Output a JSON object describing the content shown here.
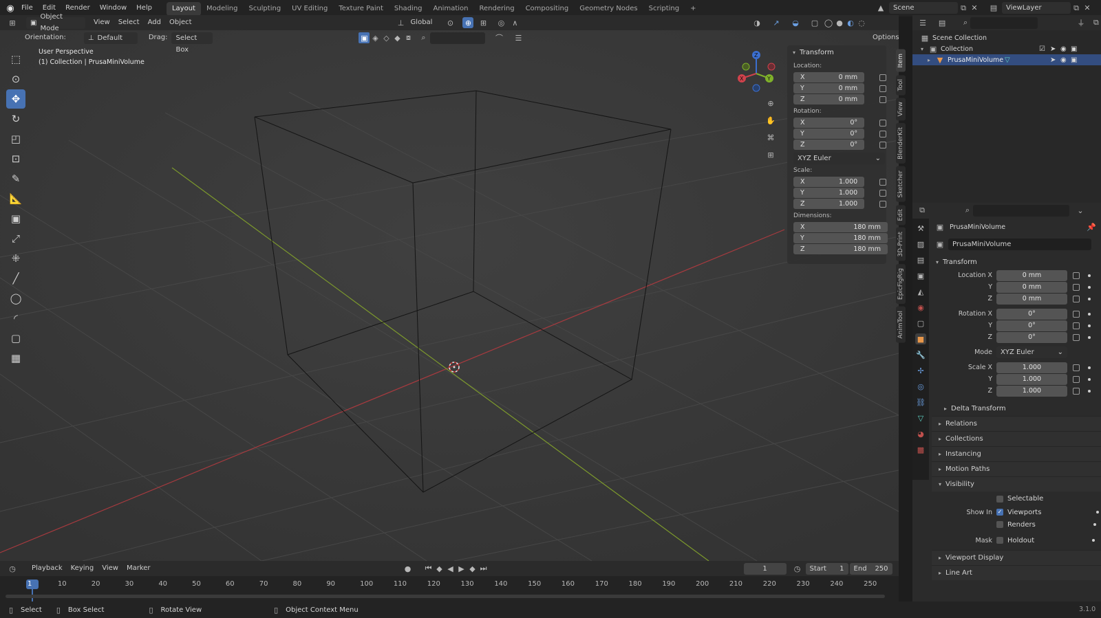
{
  "topbar": {
    "menus": [
      "File",
      "Edit",
      "Render",
      "Window",
      "Help"
    ],
    "workspaces": [
      "Layout",
      "Modeling",
      "Sculpting",
      "UV Editing",
      "Texture Paint",
      "Shading",
      "Animation",
      "Rendering",
      "Compositing",
      "Geometry Nodes",
      "Scripting"
    ],
    "active_workspace": "Layout",
    "plus": "+",
    "scene": "Scene",
    "view_layer": "ViewLayer"
  },
  "viewport_header": {
    "mode": "Object Mode",
    "menus": [
      "View",
      "Select",
      "Add",
      "Object"
    ],
    "transform_space": "Global",
    "orientation_label": "Orientation:",
    "orientation_value": "Default",
    "drag_label": "Drag:",
    "drag_value": "Select Box",
    "options": "Options"
  },
  "viewport": {
    "perspective": "User Perspective",
    "collection_info": "(1) Collection | PrusaMiniVolume"
  },
  "npanel": {
    "title": "Transform",
    "location_label": "Location:",
    "location": [
      {
        "axis": "X",
        "value": "0 mm"
      },
      {
        "axis": "Y",
        "value": "0 mm"
      },
      {
        "axis": "Z",
        "value": "0 mm"
      }
    ],
    "rotation_label": "Rotation:",
    "rotation": [
      {
        "axis": "X",
        "value": "0°"
      },
      {
        "axis": "Y",
        "value": "0°"
      },
      {
        "axis": "Z",
        "value": "0°"
      }
    ],
    "rotation_mode": "XYZ Euler",
    "scale_label": "Scale:",
    "scale": [
      {
        "axis": "X",
        "value": "1.000"
      },
      {
        "axis": "Y",
        "value": "1.000"
      },
      {
        "axis": "Z",
        "value": "1.000"
      }
    ],
    "dimensions_label": "Dimensions:",
    "dimensions": [
      {
        "axis": "X",
        "value": "180 mm"
      },
      {
        "axis": "Y",
        "value": "180 mm"
      },
      {
        "axis": "Z",
        "value": "180 mm"
      }
    ],
    "tabs": [
      "Item",
      "Tool",
      "View",
      "BlenderKit",
      "Sketcher",
      "Edit",
      "3D-Print",
      "EpicFigRig",
      "AnimTool"
    ]
  },
  "outliner": {
    "root": "Scene Collection",
    "collection": "Collection",
    "object": "PrusaMiniVolume"
  },
  "properties": {
    "object_name": "PrusaMiniVolume",
    "data_name": "PrusaMiniVolume",
    "transform_title": "Transform",
    "location_x_label": "Location X",
    "location": [
      "0 mm",
      "0 mm",
      "0 mm"
    ],
    "rotation_x_label": "Rotation X",
    "rotation": [
      "0°",
      "0°",
      "0°"
    ],
    "mode_label": "Mode",
    "mode_value": "XYZ Euler",
    "scale_x_label": "Scale X",
    "scale": [
      "1.000",
      "1.000",
      "1.000"
    ],
    "y": "Y",
    "z": "Z",
    "delta_transform": "Delta Transform",
    "sections": [
      "Relations",
      "Collections",
      "Instancing",
      "Motion Paths"
    ],
    "visibility_title": "Visibility",
    "selectable": "Selectable",
    "show_in_label": "Show In",
    "viewports": "Viewports",
    "renders": "Renders",
    "mask_label": "Mask",
    "holdout": "Holdout",
    "viewport_display": "Viewport Display",
    "line_art": "Line Art"
  },
  "timeline": {
    "menus": [
      "Playback",
      "Keying",
      "View",
      "Marker"
    ],
    "current_frame": "1",
    "start_label": "Start",
    "start_value": "1",
    "end_label": "End",
    "end_value": "250",
    "ticks": [
      "1",
      "10",
      "20",
      "30",
      "40",
      "50",
      "60",
      "70",
      "80",
      "90",
      "100",
      "110",
      "120",
      "130",
      "140",
      "150",
      "160",
      "170",
      "180",
      "190",
      "200",
      "210",
      "220",
      "230",
      "240",
      "250"
    ]
  },
  "statusbar": {
    "select": "Select",
    "box_select": "Box Select",
    "rotate_view": "Rotate View",
    "context_menu": "Object Context Menu",
    "version": "3.1.0"
  }
}
